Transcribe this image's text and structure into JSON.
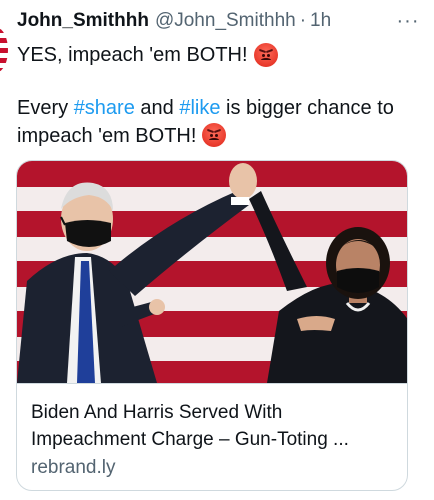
{
  "tweet": {
    "display_name": "John_Smithhh",
    "handle": "@John_Smithhh",
    "separator": "·",
    "time": "1h",
    "more_label": "···",
    "line1": "YES, impeach 'em BOTH!",
    "body": {
      "part1": "Every ",
      "hashtag1": "#share",
      "part2": " and ",
      "hashtag2": "#like",
      "part3": " is bigger chance to impeach 'em BOTH!"
    },
    "emoji_icon": "angry-face-icon"
  },
  "card": {
    "title": "Biden And Harris Served With Impeachment Charge – Gun-Toting ...",
    "domain": "rebrand.ly"
  },
  "colors": {
    "hashtag": "#1d9bf0",
    "secondary_text": "#536471",
    "stripe_red": "#c8102e"
  }
}
